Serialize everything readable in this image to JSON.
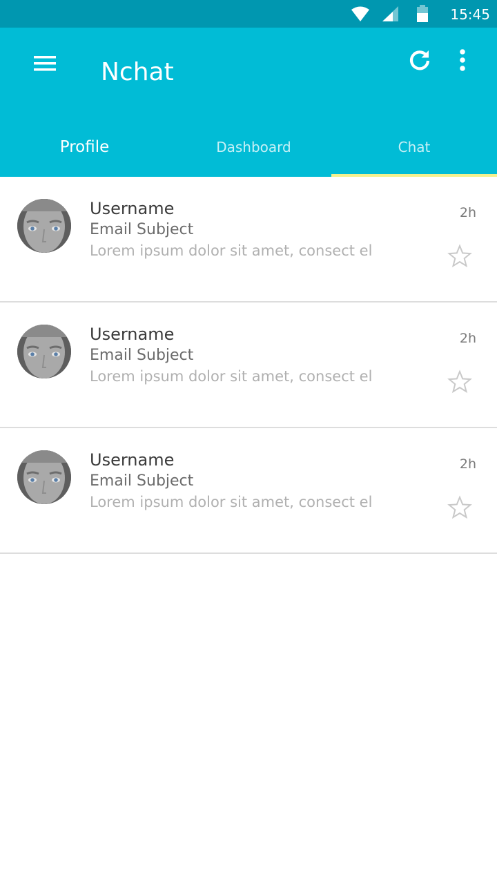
{
  "status_bar": {
    "time": "15:45",
    "icons": [
      "wifi-icon",
      "signal-icon",
      "battery-icon"
    ]
  },
  "app_bar": {
    "title": "Nchat",
    "actions": [
      "menu-icon",
      "refresh-icon",
      "more-vert-icon"
    ]
  },
  "tabs": [
    {
      "label": "Profile"
    },
    {
      "label": "Dashboard"
    },
    {
      "label": "Chat"
    }
  ],
  "selected_tab": "Chat",
  "messages": [
    {
      "username": "Username",
      "subject": "Email Subject",
      "preview": "Lorem ipsum dolor sit amet, consect elity...",
      "time": "2h",
      "starred": false
    },
    {
      "username": "Username",
      "subject": "Email Subject",
      "preview": "Lorem ipsum dolor sit amet, consect elity...",
      "time": "2h",
      "starred": false
    },
    {
      "username": "Username",
      "subject": "Email Subject",
      "preview": "Lorem ipsum dolor sit amet, consect elity...",
      "time": "2h",
      "starred": false
    }
  ],
  "colors": {
    "status_bar": "#0097b0",
    "app_bar": "#01bcd6",
    "tab_indicator": "#f4f18e",
    "divider": "#dddddd"
  }
}
